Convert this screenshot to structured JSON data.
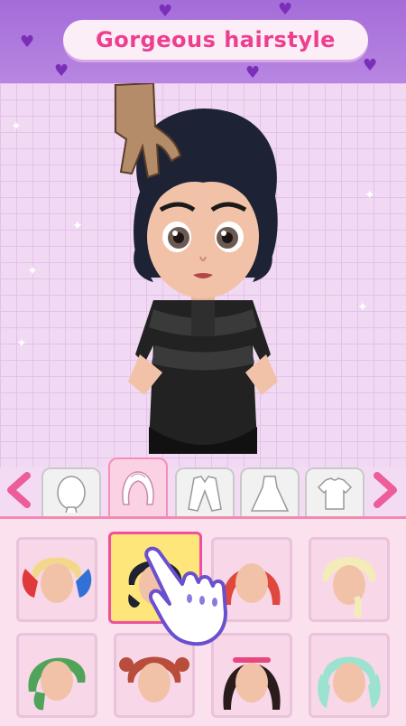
{
  "header": {
    "title": "Gorgeous hairstyle"
  },
  "categories": [
    {
      "id": "face",
      "icon": "face-icon",
      "selected": false
    },
    {
      "id": "hair",
      "icon": "hair-icon",
      "selected": true
    },
    {
      "id": "jacket",
      "icon": "jacket-icon",
      "selected": false
    },
    {
      "id": "dress",
      "icon": "dress-icon",
      "selected": false
    },
    {
      "id": "top",
      "icon": "top-icon",
      "selected": false
    }
  ],
  "hairstyles": [
    {
      "name": "blonde-red-blue-pigtails",
      "colors": [
        "#f3d88b",
        "#e0393c",
        "#3170d6"
      ],
      "selected": false
    },
    {
      "name": "black-updo",
      "colors": [
        "#1f2230"
      ],
      "selected": true
    },
    {
      "name": "red-short-bob",
      "colors": [
        "#e0473d"
      ],
      "selected": false
    },
    {
      "name": "platinum-braid",
      "colors": [
        "#f3ecb8"
      ],
      "selected": false
    },
    {
      "name": "green-side-braid",
      "colors": [
        "#4fa45a"
      ],
      "selected": false
    },
    {
      "name": "auburn-pigtails",
      "colors": [
        "#b84d3c"
      ],
      "selected": false
    },
    {
      "name": "black-dreadlocks",
      "colors": [
        "#2a1c1c",
        "#e8467e"
      ],
      "selected": false
    },
    {
      "name": "mint-pigtails",
      "colors": [
        "#9be3d0"
      ],
      "selected": false
    }
  ],
  "colors": {
    "accent": "#ee3f8f",
    "banner": "#a46cd8",
    "panel": "#fbe0ee"
  }
}
